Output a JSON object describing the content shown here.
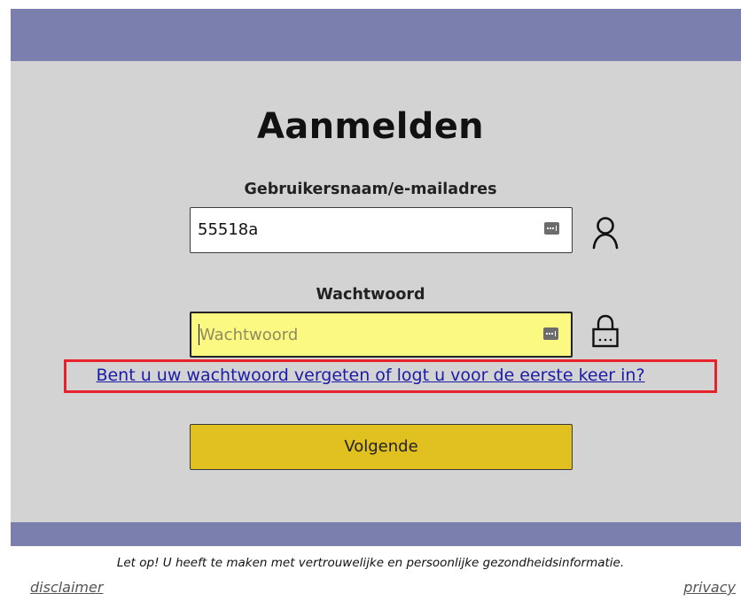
{
  "page": {
    "title": "Aanmelden"
  },
  "form": {
    "username": {
      "label": "Gebruikersnaam/e-mailadres",
      "value": "55518a",
      "icon": "user-icon"
    },
    "password": {
      "label": "Wachtwoord",
      "value": "",
      "placeholder": "Wachtwoord",
      "icon": "lock-icon"
    },
    "forgot_link": "Bent u uw wachtwoord vergeten of logt u voor de eerste keer in?",
    "next_button": "Volgende"
  },
  "footer": {
    "notice": "Let op! U heeft te maken met vertrouwelijke en persoonlijke gezondheidsinformatie.",
    "disclaimer": "disclaimer",
    "privacy": "privacy"
  },
  "colors": {
    "header_bar": "#7a7fad",
    "panel": "#d3d3d3",
    "button": "#e1c11f",
    "active_input": "#fbf981",
    "link": "#1b1ba8",
    "highlight_box": "#e8222b"
  }
}
